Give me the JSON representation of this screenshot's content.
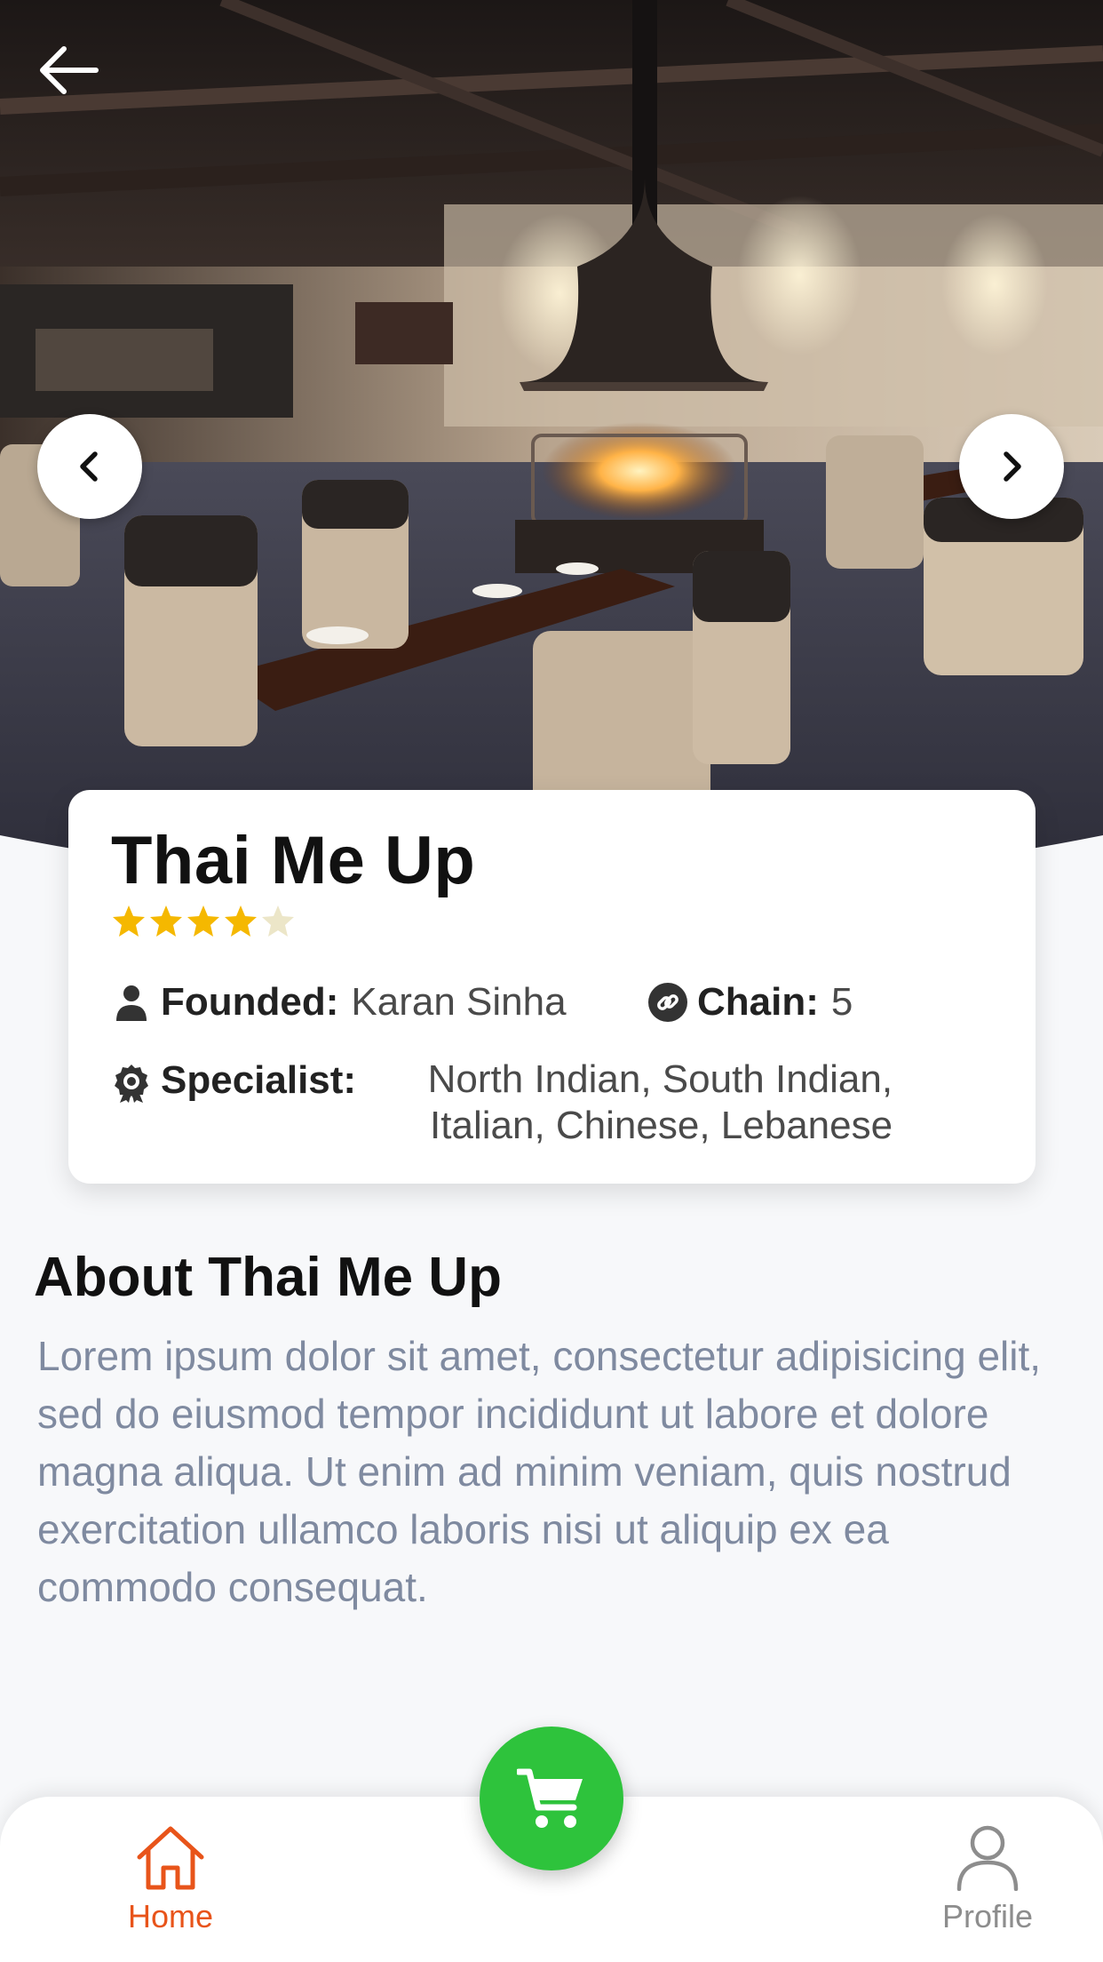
{
  "hero": {
    "image": "restaurant-interior-photo",
    "back_icon": "arrow-left-icon",
    "prev_icon": "chevron-left-icon",
    "next_icon": "chevron-right-icon"
  },
  "restaurant": {
    "name": "Thai Me Up",
    "rating": 4,
    "rating_max": 5,
    "founded_label": "Founded:",
    "founded_value": "Karan Sinha",
    "chain_label": "Chain:",
    "chain_value": "5",
    "specialist_label": "Specialist:",
    "specialist_value": "North Indian, South Indian, Italian, Chinese, Lebanese"
  },
  "about": {
    "title": "About Thai Me Up",
    "text": "Lorem ipsum dolor sit amet, consectetur adipisicing elit, sed do eiusmod tempor incididunt ut labore et dolore magna aliqua. Ut enim ad minim veniam, quis nostrud exercitation ullamco laboris nisi ut aliquip ex ea commodo consequat."
  },
  "bottom_nav": {
    "home_label": "Home",
    "profile_label": "Profile",
    "cart_icon": "cart-icon"
  },
  "colors": {
    "accent": "#e8541a",
    "cart_green": "#2ec33c",
    "star": "#f5b800",
    "star_empty": "#ece6c8",
    "muted_text": "#7f8aa0"
  }
}
